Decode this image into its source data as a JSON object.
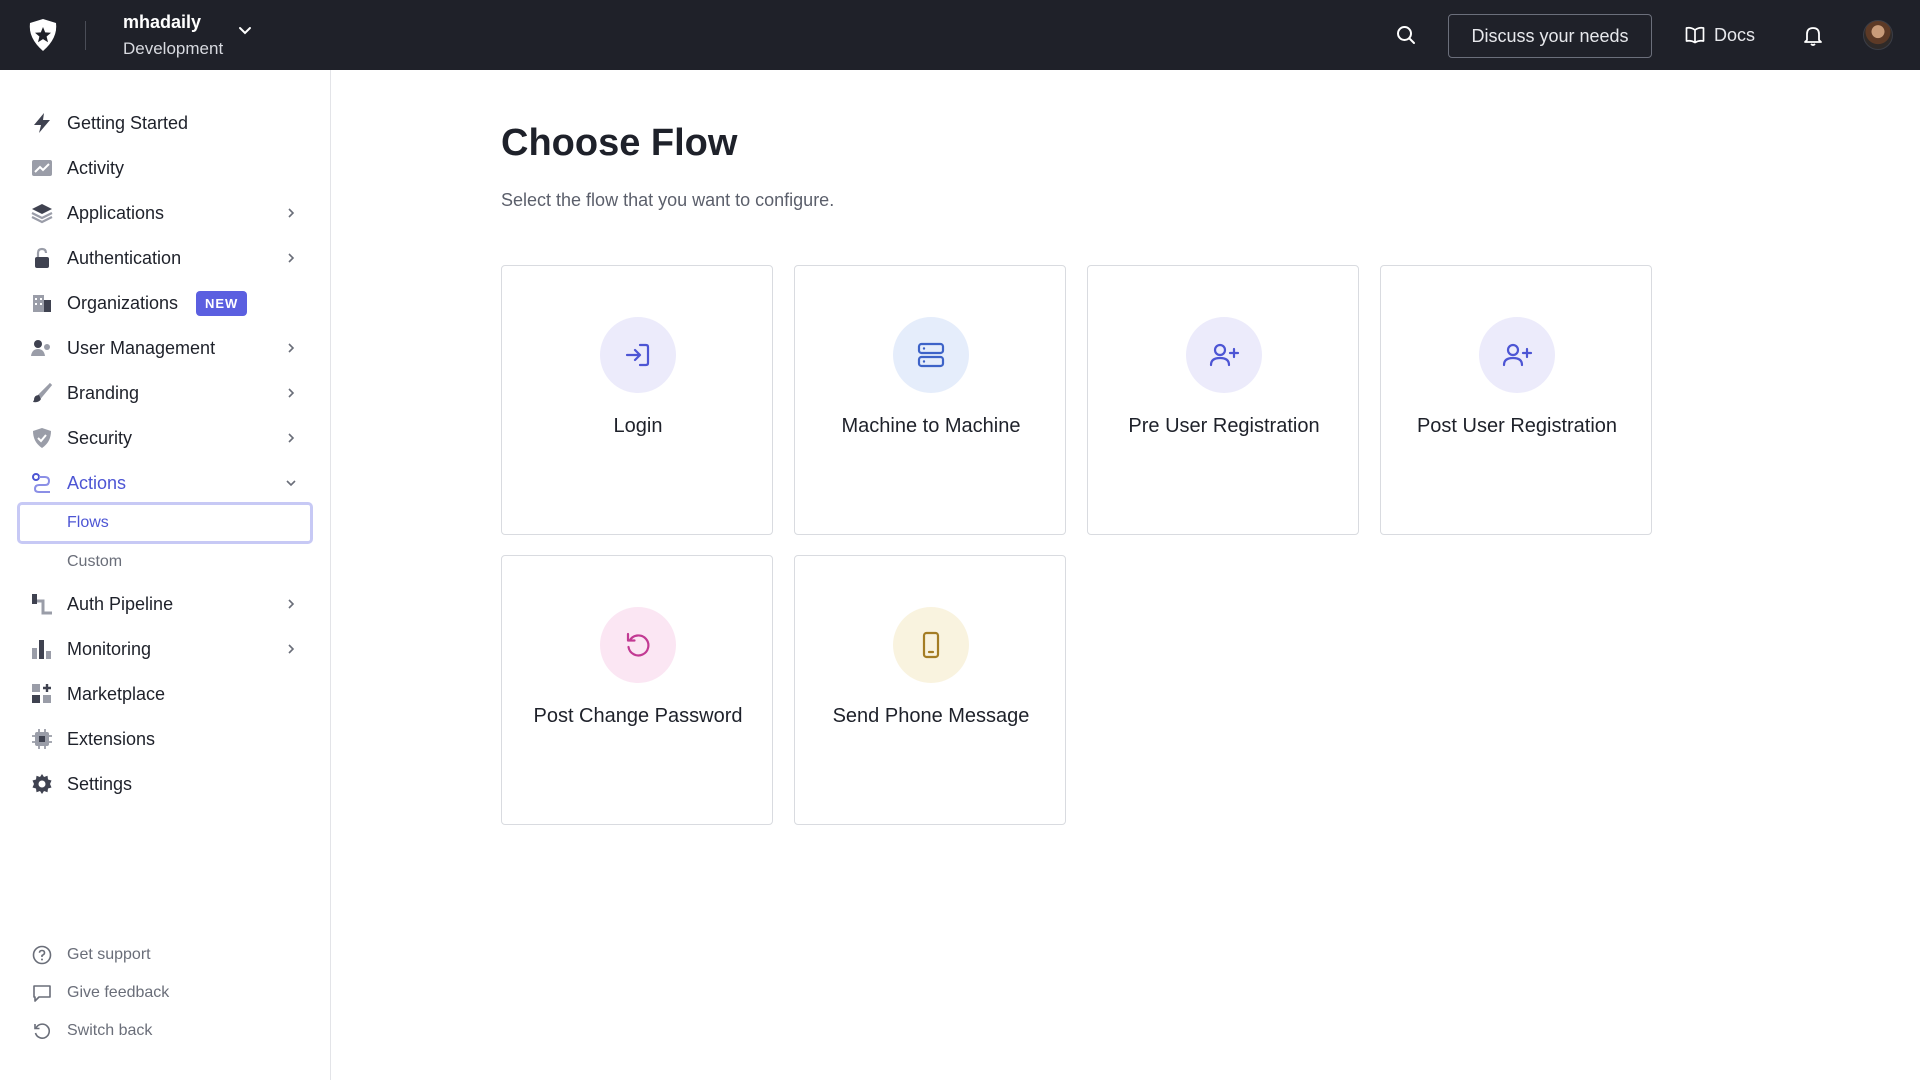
{
  "header": {
    "tenant_name": "mhadaily",
    "tenant_env": "Development",
    "discuss_label": "Discuss your needs",
    "docs_label": "Docs"
  },
  "sidebar": {
    "items": [
      {
        "label": "Getting Started",
        "icon": "lightning-icon"
      },
      {
        "label": "Activity",
        "icon": "chart-line-icon"
      },
      {
        "label": "Applications",
        "icon": "layers-icon"
      },
      {
        "label": "Authentication",
        "icon": "lock-icon"
      },
      {
        "label": "Organizations",
        "icon": "building-icon",
        "badge": "NEW"
      },
      {
        "label": "User Management",
        "icon": "users-icon"
      },
      {
        "label": "Branding",
        "icon": "brush-icon"
      },
      {
        "label": "Security",
        "icon": "shield-icon"
      },
      {
        "label": "Actions",
        "icon": "flow-icon"
      },
      {
        "label": "Auth Pipeline",
        "icon": "pipeline-icon"
      },
      {
        "label": "Monitoring",
        "icon": "bar-chart-icon"
      },
      {
        "label": "Marketplace",
        "icon": "grid-plus-icon"
      },
      {
        "label": "Extensions",
        "icon": "chip-icon"
      },
      {
        "label": "Settings",
        "icon": "gear-icon"
      }
    ],
    "sub_items": [
      {
        "label": "Flows"
      },
      {
        "label": "Custom"
      }
    ],
    "footer": [
      {
        "label": "Get support",
        "icon": "help-circle-icon"
      },
      {
        "label": "Give feedback",
        "icon": "message-icon"
      },
      {
        "label": "Switch back",
        "icon": "rotate-icon"
      }
    ]
  },
  "main": {
    "title": "Choose Flow",
    "subtitle": "Select the flow that you want to configure.",
    "flows": [
      {
        "label": "Login",
        "icon": "login-icon",
        "bg": "#ecebfb",
        "color": "#4d55d4"
      },
      {
        "label": "Machine to Machine",
        "icon": "server-icon",
        "bg": "#e5edfb",
        "color": "#3d63c8"
      },
      {
        "label": "Pre User Registration",
        "icon": "user-plus-icon",
        "bg": "#ecebfb",
        "color": "#4d55d4"
      },
      {
        "label": "Post User Registration",
        "icon": "user-plus-icon",
        "bg": "#ecebfb",
        "color": "#4d55d4"
      },
      {
        "label": "Post Change Password",
        "icon": "rotate-icon",
        "bg": "#fbe6f3",
        "color": "#c23a93"
      },
      {
        "label": "Send Phone Message",
        "icon": "phone-icon",
        "bg": "#f9f3df",
        "color": "#a47d25"
      }
    ]
  },
  "colors": {
    "topbar": "#1f2129",
    "accent": "#4d55d4",
    "badge": "#5b5fe0"
  }
}
